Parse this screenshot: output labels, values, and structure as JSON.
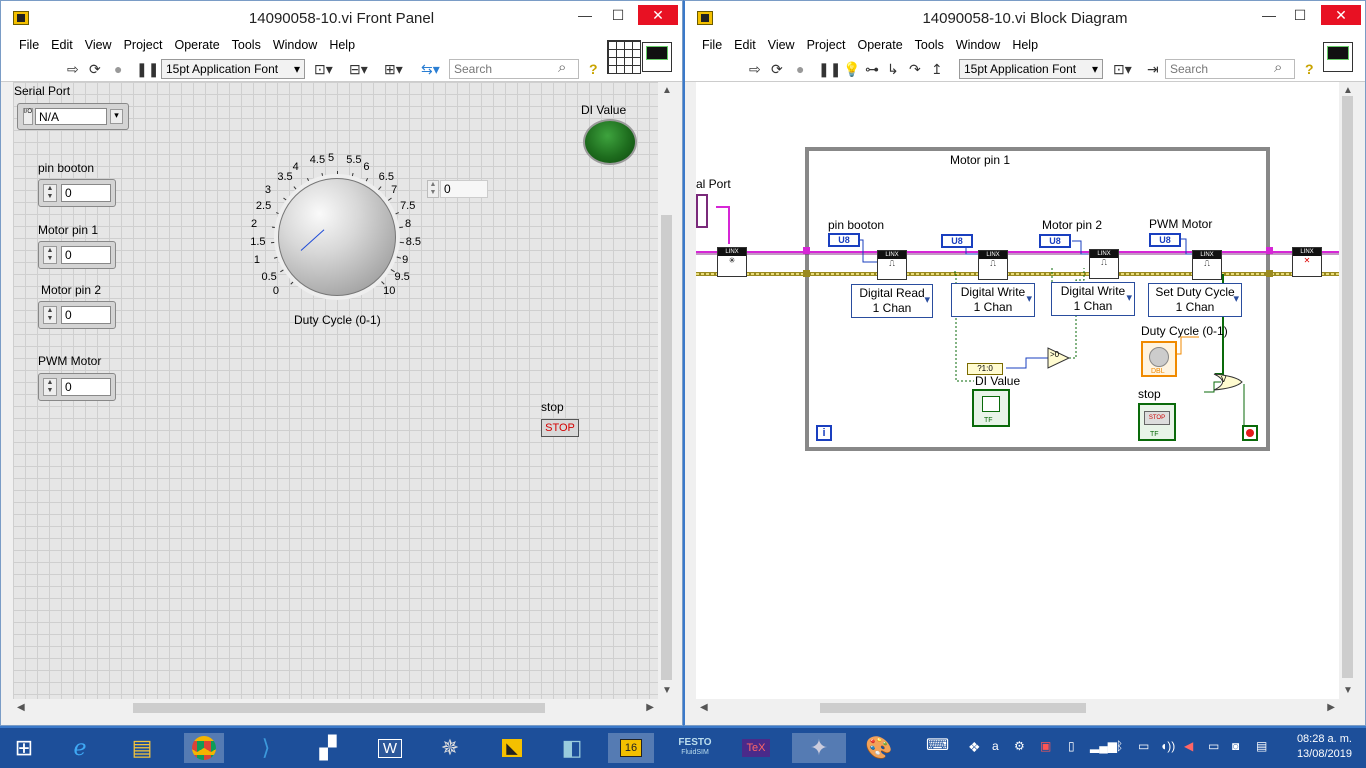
{
  "front_panel": {
    "title": "14090058-10.vi Front Panel",
    "menu": [
      "File",
      "Edit",
      "View",
      "Project",
      "Operate",
      "Tools",
      "Window",
      "Help"
    ],
    "font_selector": "15pt Application Font",
    "search_placeholder": "Search",
    "serial_port": {
      "label": "Serial Port",
      "value": "N/A"
    },
    "pin_booton": {
      "label": "pin booton",
      "value": "0"
    },
    "motor_pin_1": {
      "label": "Motor pin 1",
      "value": "0"
    },
    "motor_pin_2": {
      "label": "Motor pin 2",
      "value": "0"
    },
    "pwm_motor": {
      "label": "PWM Motor",
      "value": "0"
    },
    "knob": {
      "label": "Duty Cycle (0-1)",
      "digital_value": "0",
      "ticks": [
        "0",
        "0.5",
        "1",
        "1.5",
        "2",
        "2.5",
        "3",
        "3.5",
        "4",
        "4.5",
        "5",
        "5.5",
        "6",
        "6.5",
        "7",
        "7.5",
        "8",
        "8.5",
        "9",
        "9.5",
        "10"
      ]
    },
    "di_value": {
      "label": "DI Value",
      "state": "on",
      "color": "#1e6d1e"
    },
    "stop": {
      "label": "stop",
      "button_text": "STOP"
    }
  },
  "block_diagram": {
    "title": "14090058-10.vi Block Diagram",
    "menu": [
      "File",
      "Edit",
      "View",
      "Project",
      "Operate",
      "Tools",
      "Window",
      "Help"
    ],
    "font_selector": "15pt Application Font",
    "search_placeholder": "Search",
    "loop_label": "Motor pin 1",
    "serial_port_label": "al Port",
    "terminals": {
      "pin_booton": "pin booton",
      "motor_pin_2": "Motor pin 2",
      "pwm_motor": "PWM Motor",
      "duty_cycle": "Duty Cycle (0-1)",
      "di_value": "DI Value",
      "stop": "stop"
    },
    "u8": "U8",
    "linx": "LINX",
    "selectors": [
      {
        "line1": "Digital Read",
        "line2": "1 Chan"
      },
      {
        "line1": "Digital Write",
        "line2": "1 Chan"
      },
      {
        "line1": "Digital Write",
        "line2": "1 Chan"
      },
      {
        "line1": "Set Duty Cycle",
        "line2": "1 Chan"
      }
    ],
    "tf": "TF",
    "dbl": "DBL",
    "stop_text": "STOP",
    "bool_to_num": "?1:0",
    "gt0": ">0",
    "or": "V",
    "iteration": "i"
  },
  "taskbar": {
    "clock_time": "08:28 a. m.",
    "clock_date": "13/08/2019",
    "festo": "FESTO",
    "fluidsim": "FluidSIM",
    "tex": "TeX",
    "labview_badge": "16",
    "word": "W"
  }
}
